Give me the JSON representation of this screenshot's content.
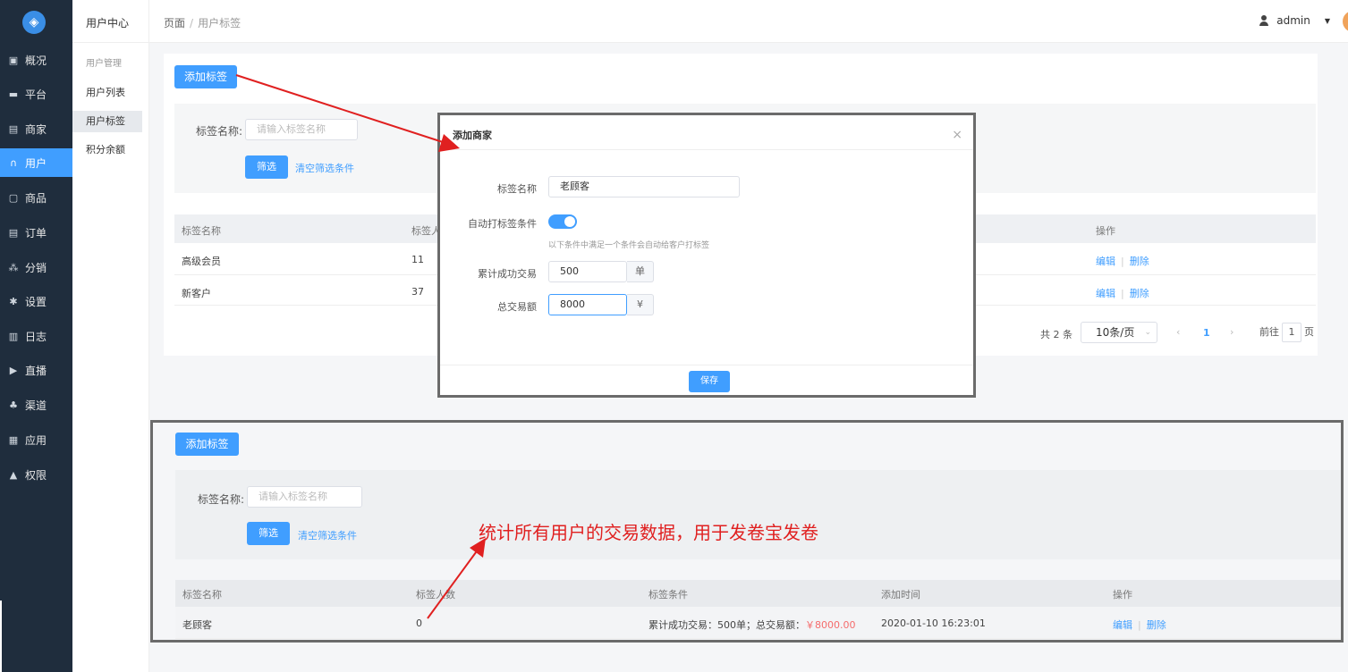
{
  "sidebar": {
    "logo_icon": "cube-logo",
    "items": [
      {
        "label": "概况",
        "icon": "monitor-icon"
      },
      {
        "label": "平台",
        "icon": "desktop-icon"
      },
      {
        "label": "商家",
        "icon": "store-icon"
      },
      {
        "label": "用户",
        "icon": "headset-icon",
        "active": true
      },
      {
        "label": "商品",
        "icon": "goods-icon"
      },
      {
        "label": "订单",
        "icon": "order-icon"
      },
      {
        "label": "分销",
        "icon": "sitemap-icon"
      },
      {
        "label": "设置",
        "icon": "gear-icon"
      },
      {
        "label": "日志",
        "icon": "book-icon"
      },
      {
        "label": "直播",
        "icon": "live-icon"
      },
      {
        "label": "渠道",
        "icon": "cubes-icon"
      },
      {
        "label": "应用",
        "icon": "grid-icon"
      },
      {
        "label": "权限",
        "icon": "lock-icon"
      }
    ]
  },
  "subnav": {
    "title": "用户中心",
    "group": "用户管理",
    "items": [
      "用户列表",
      "用户标签",
      "积分余额"
    ]
  },
  "header": {
    "crumb_root": "页面",
    "crumb_sep": "/",
    "crumb_current": "用户标签",
    "username": "admin"
  },
  "page": {
    "add_button": "添加标签",
    "filter_label": "标签名称:",
    "filter_placeholder": "请输入标签名称",
    "filter_button": "筛选",
    "clear_link": "清空筛选条件",
    "columns": [
      "标签名称",
      "标签人",
      "操作"
    ],
    "rows": [
      {
        "name": "高级会员",
        "count": "11"
      },
      {
        "name": "新客户",
        "count": "37"
      }
    ],
    "edit": "编辑",
    "delete": "删除",
    "pager": {
      "total": "共 2 条",
      "page_size": "10条/页",
      "current": "1",
      "goto_prefix": "前往",
      "goto_value": "1",
      "goto_suffix": "页"
    }
  },
  "modal": {
    "title": "添加商家",
    "name_label": "标签名称",
    "name_value": "老顾客",
    "auto_label": "自动打标签条件",
    "auto_enabled": true,
    "hint": "以下条件中满足一个条件会自动给客户打标签",
    "trade_label": "累计成功交易",
    "trade_value": "500",
    "trade_unit": "单",
    "amount_label": "总交易额",
    "amount_value": "8000",
    "amount_unit": "¥",
    "save": "保存"
  },
  "result": {
    "add_button": "添加标签",
    "filter_label": "标签名称:",
    "filter_placeholder": "请输入标签名称",
    "filter_button": "筛选",
    "clear_link": "清空筛选条件",
    "columns": [
      "标签名称",
      "标签人数",
      "标签条件",
      "添加时间",
      "操作"
    ],
    "row": {
      "name": "老顾客",
      "count": "0",
      "condition_prefix": "累计成功交易：500单；总交易额：",
      "condition_amount": "￥8000.00",
      "time": "2020-01-10 16:23:01"
    },
    "edit": "编辑",
    "delete": "删除"
  },
  "annotation": "统计所有用户的交易数据，用于发卷宝发卷",
  "colors": {
    "primary": "#409eff",
    "sidebar": "#1f2d3d",
    "annotation": "#e02020",
    "price": "#f56c6c"
  }
}
